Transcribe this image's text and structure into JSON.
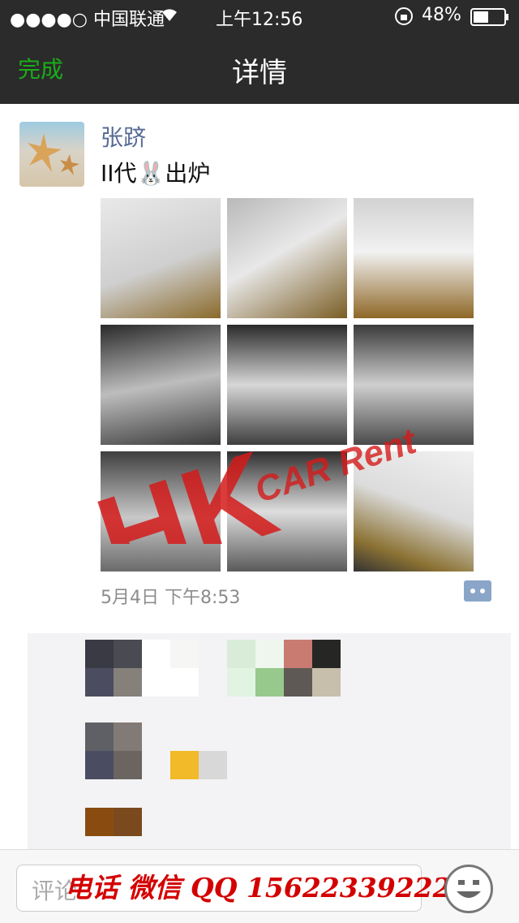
{
  "status_bar": {
    "carrier": "●●●●○ 中国联通",
    "time": "上午12:56",
    "battery": "48%"
  },
  "nav": {
    "done": "完成",
    "title": "详情"
  },
  "post": {
    "user": "张跻",
    "text": "II代🐰出炉",
    "time": "5月4日 下午8:53",
    "photo_count": 9
  },
  "watermark": {
    "text": "HK",
    "subtext": "CAR Rent"
  },
  "comment_bar": {
    "placeholder": "评论",
    "overlay": "电话 微信 QQ 15622339222"
  },
  "colors": {
    "nav_bg": "#2b2b2b",
    "accent_green": "#1aad19",
    "name_blue": "#576b95",
    "overlay_red": "#d40000"
  }
}
